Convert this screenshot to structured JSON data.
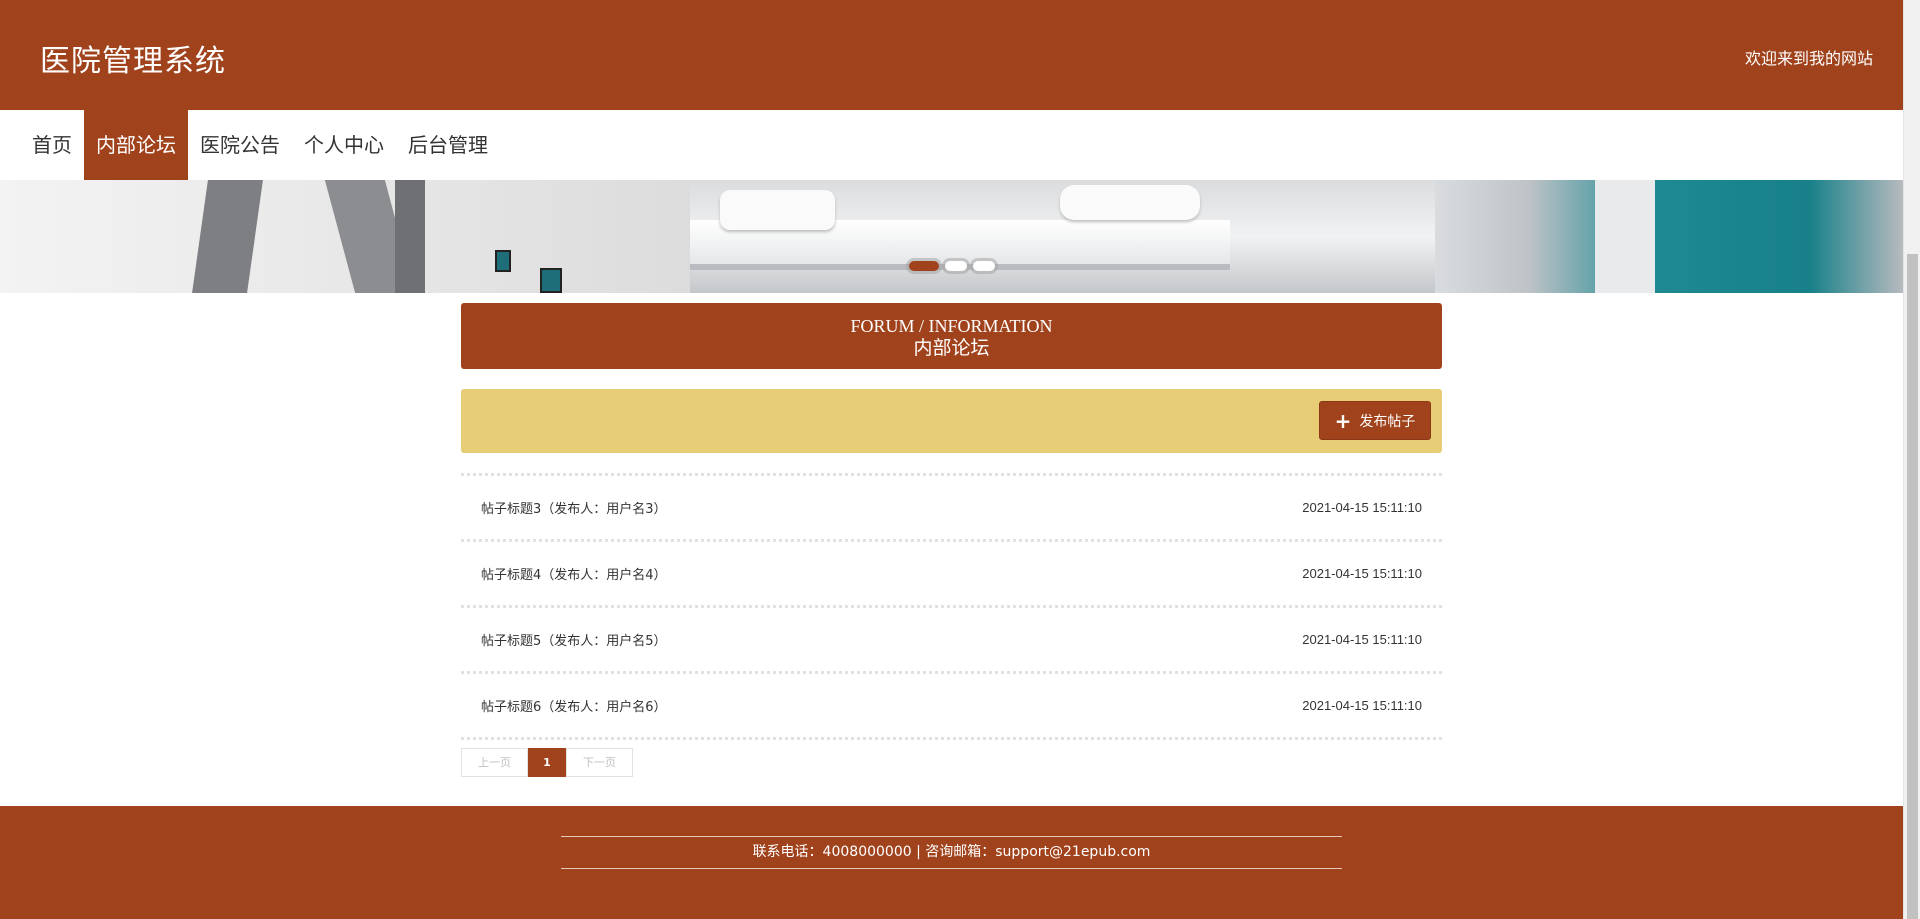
{
  "header": {
    "site_title": "医院管理系统",
    "welcome_text": "欢迎来到我的网站"
  },
  "nav": {
    "items": [
      {
        "label": "首页",
        "active": false
      },
      {
        "label": "内部论坛",
        "active": true
      },
      {
        "label": "医院公告",
        "active": false
      },
      {
        "label": "个人中心",
        "active": false
      },
      {
        "label": "后台管理",
        "active": false
      }
    ]
  },
  "banner": {
    "slide_count": 3,
    "active_slide": 1
  },
  "section": {
    "title_en": "FORUM / INFORMATION",
    "title_cn": "内部论坛"
  },
  "toolbar": {
    "publish_label": "发布帖子",
    "publish_icon": "plus-icon"
  },
  "posts": [
    {
      "title": "帖子标题3（发布人：用户名3）",
      "time": "2021-04-15 15:11:10"
    },
    {
      "title": "帖子标题4（发布人：用户名4）",
      "time": "2021-04-15 15:11:10"
    },
    {
      "title": "帖子标题5（发布人：用户名5）",
      "time": "2021-04-15 15:11:10"
    },
    {
      "title": "帖子标题6（发布人：用户名6）",
      "time": "2021-04-15 15:11:10"
    }
  ],
  "pagination": {
    "prev_label": "上一页",
    "current_page": "1",
    "next_label": "下一页"
  },
  "footer": {
    "contact_text": "联系电话：4008000000 | 咨询邮箱：support@21epub.com"
  },
  "colors": {
    "brand": "#a0431c",
    "toolbar_bg": "#e7cd76"
  }
}
